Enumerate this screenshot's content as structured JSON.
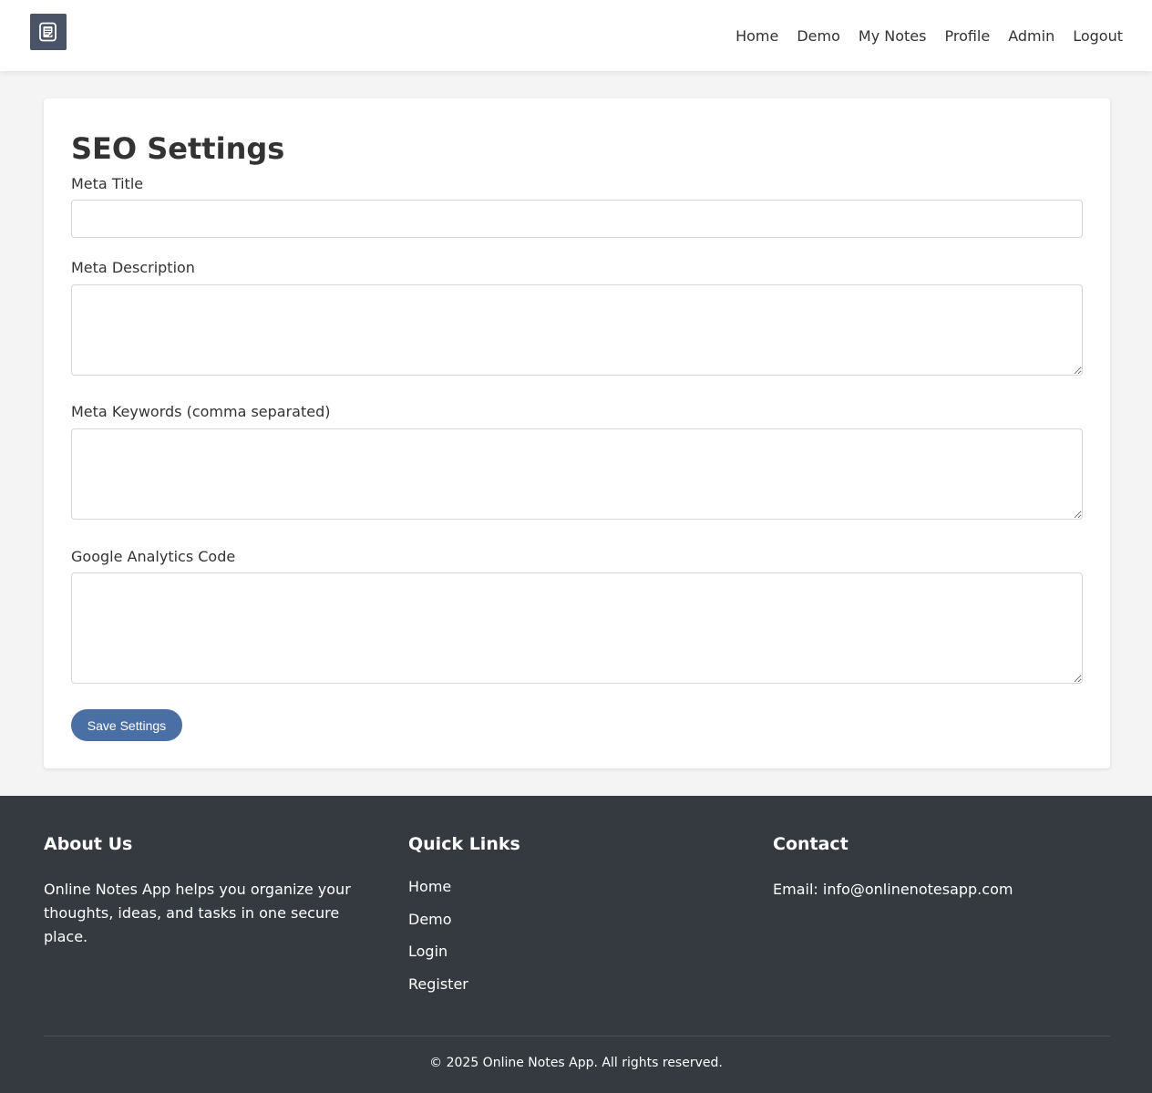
{
  "nav": {
    "logo_icon": "notepad-icon",
    "links": [
      "Home",
      "Demo",
      "My Notes",
      "Profile",
      "Admin",
      "Logout"
    ]
  },
  "form": {
    "title": "SEO Settings",
    "meta_title_label": "Meta Title",
    "meta_title_value": "",
    "meta_description_label": "Meta Description",
    "meta_description_value": "",
    "meta_keywords_label": "Meta Keywords (comma separated)",
    "meta_keywords_value": "",
    "analytics_label": "Google Analytics Code",
    "analytics_value": "",
    "save_label": "Save Settings"
  },
  "footer": {
    "about_title": "About Us",
    "about_text": "Online Notes App helps you organize your thoughts, ideas, and tasks in one secure place.",
    "links_title": "Quick Links",
    "links": [
      "Home",
      "Demo",
      "Login",
      "Register"
    ],
    "contact_title": "Contact",
    "contact_email": "Email: info@onlinenotesapp.com",
    "copyright": "© 2025 Online Notes App. All rights reserved."
  },
  "colors": {
    "accent": "#4a6fa5",
    "footer_bg": "#343a40",
    "logo_bg": "#4a5466"
  }
}
